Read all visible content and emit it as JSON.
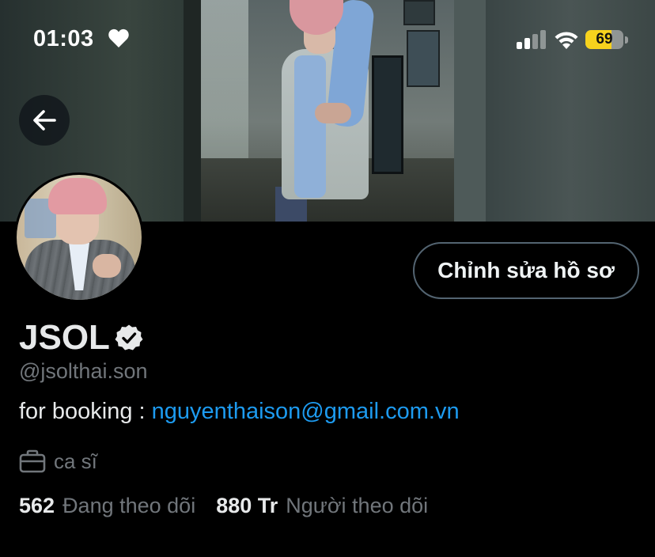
{
  "status_bar": {
    "time": "01:03",
    "battery_level": "69",
    "battery_fraction": 0.69,
    "icons": [
      "heart-icon",
      "cellular-signal-icon",
      "wifi-icon",
      "battery-icon"
    ]
  },
  "header": {
    "back_icon": "arrow-left-icon"
  },
  "profile": {
    "display_name": "JSOL",
    "verified_icon": "verified-badge-icon",
    "handle": "@jsolthai.son",
    "bio_prefix": "for booking : ",
    "bio_email": "nguyenthaison@gmail.com.vn",
    "job_icon": "briefcase-icon",
    "job": "ca sĩ",
    "following_count": "562",
    "following_label": "Đang theo dõi",
    "followers_count": "880 Tr",
    "followers_label": "Người theo dõi"
  },
  "actions": {
    "edit_profile_label": "Chỉnh sửa hồ sơ"
  },
  "colors": {
    "background": "#000000",
    "link": "#1d9bf0",
    "muted_text": "#71767b",
    "battery_accent": "#f7d21d"
  }
}
